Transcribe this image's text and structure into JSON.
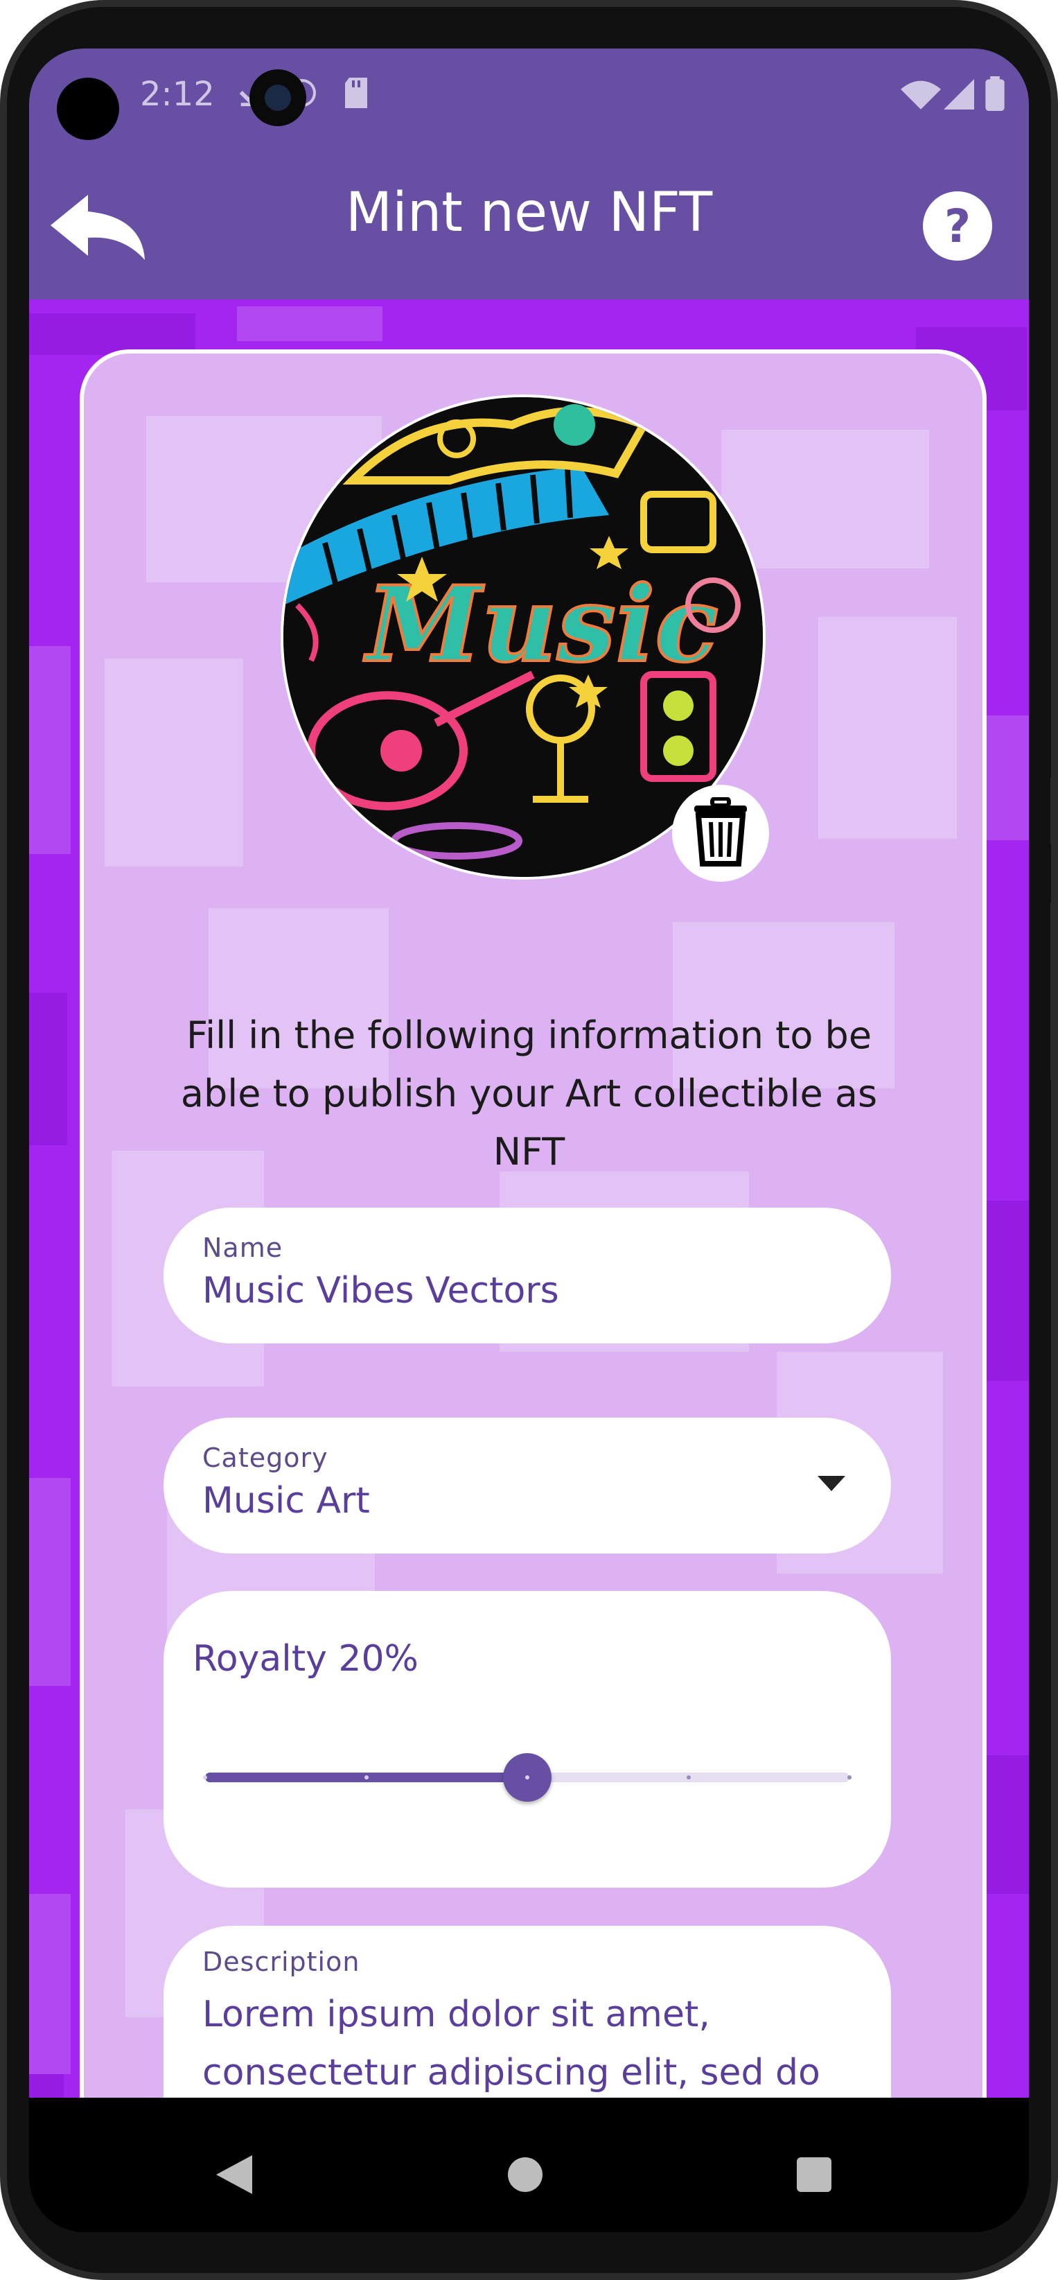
{
  "status_bar": {
    "time": "2:12"
  },
  "app_bar": {
    "title": "Mint new NFT",
    "back_icon": "reply-arrow-icon",
    "help_label": "?"
  },
  "artwork": {
    "title_art_text": "Music",
    "delete_icon": "trash-icon"
  },
  "instructions": "Fill in the following information to be able to publish your Art collectible as NFT",
  "form": {
    "name": {
      "label": "Name",
      "value": "Music Vibes Vectors"
    },
    "category": {
      "label": "Category",
      "value": "Music Art"
    },
    "royalty": {
      "label": "Royalty 20%",
      "value_fraction": 0.5,
      "steps": 5
    },
    "description": {
      "label": "Description",
      "value": "Lorem ipsum dolor sit amet, consectetur adipiscing elit, sed do"
    }
  },
  "colors": {
    "primary": "#6750a4",
    "background": "#a425ef",
    "card": "#dcb2f3"
  }
}
